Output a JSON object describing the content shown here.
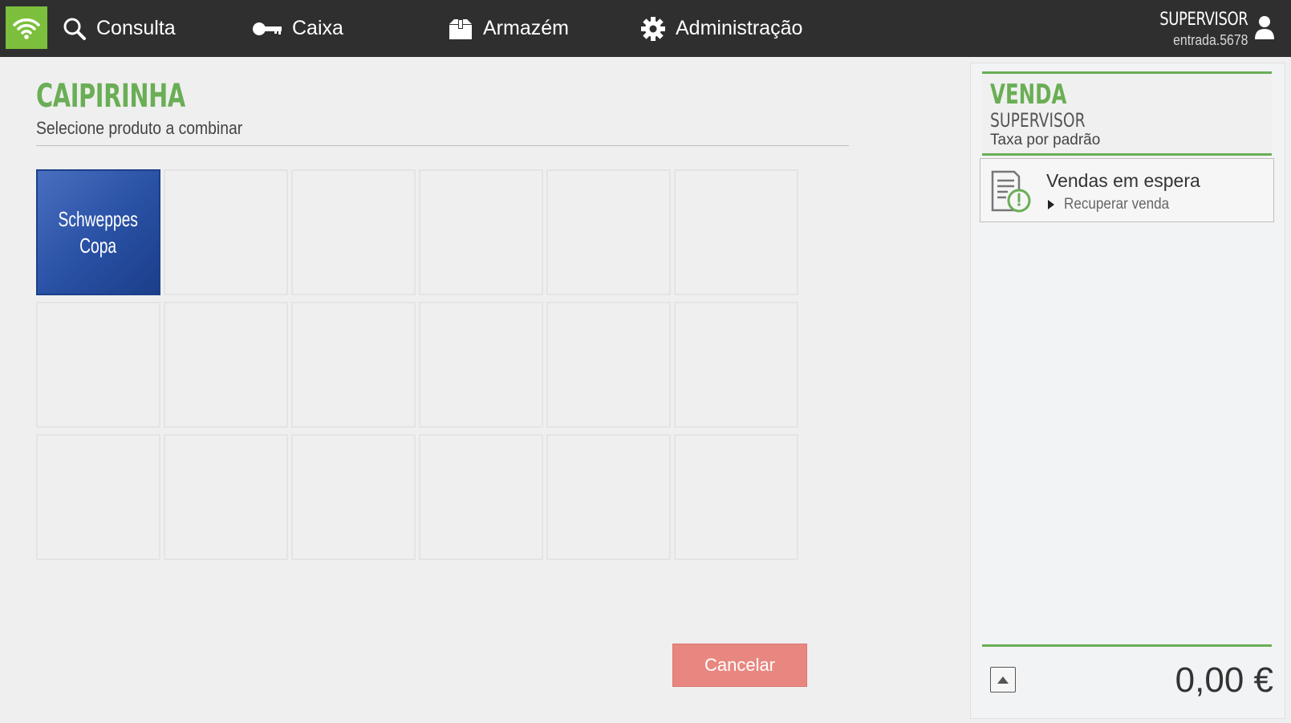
{
  "topbar": {
    "nav": [
      {
        "label": "Consulta",
        "icon": "search-icon"
      },
      {
        "label": "Caixa",
        "icon": "key-icon"
      },
      {
        "label": "Armazém",
        "icon": "box-icon"
      },
      {
        "label": "Administração",
        "icon": "gear-icon"
      }
    ],
    "user": {
      "name": "SUPERVISOR",
      "login": "entrada.5678",
      "icon": "user-icon"
    },
    "status_icon": "wifi-icon",
    "accent_color": "#7cbf3c"
  },
  "main": {
    "title": "CAIPIRINHA",
    "subtitle": "Selecione produto a combinar",
    "products": [
      {
        "line1": "Schweppes",
        "line2": "Copa"
      }
    ],
    "cancel_label": "Cancelar"
  },
  "sale": {
    "title": "VENDA",
    "user": "SUPERVISOR",
    "tax": "Taxa por padrão",
    "hold": {
      "title": "Vendas em espera",
      "link": "Recuperar venda",
      "icon": "pending-sale-icon"
    },
    "total": "0,00 €"
  },
  "colors": {
    "green": "#6aae55",
    "product_tile": "#2a52a6",
    "cancel": "#e88780",
    "topbar": "#2f2f2f"
  }
}
